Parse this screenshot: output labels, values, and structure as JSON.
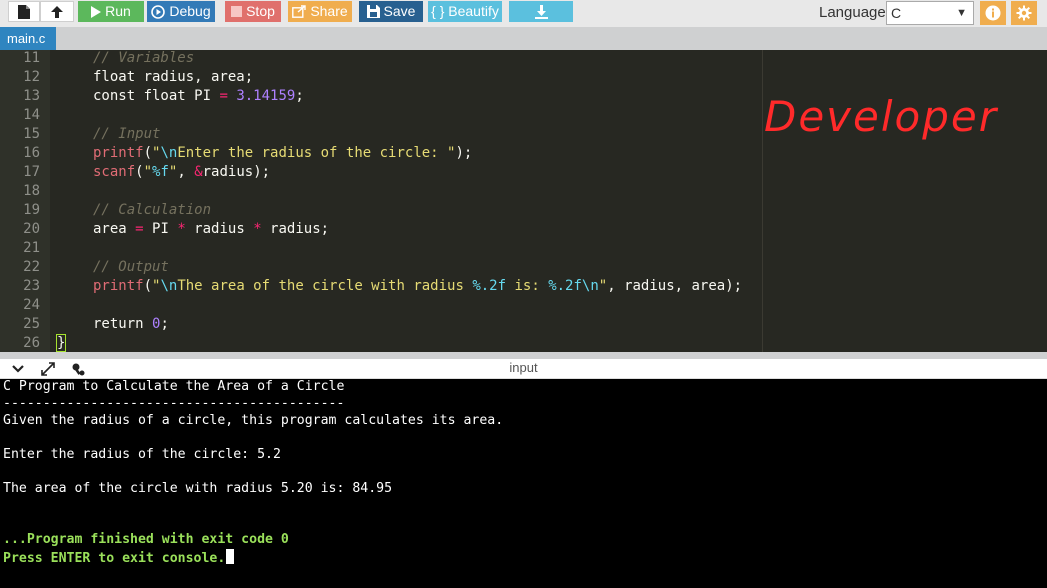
{
  "toolbar": {
    "run_label": "Run",
    "debug_label": "Debug",
    "stop_label": "Stop",
    "share_label": "Share",
    "save_label": "Save",
    "beautify_label": "{ } Beautify",
    "language_label": "Language",
    "language_value": "C",
    "icons": [
      "new-file-icon",
      "upload-icon",
      "play-icon",
      "debug-icon",
      "stop-icon",
      "share-icon",
      "save-icon",
      "download-icon",
      "info-icon",
      "gear-icon"
    ],
    "colors": {
      "run": "#5cb85c",
      "debug": "#337ab7",
      "stop": "#d9534f",
      "share": "#f0ad4e",
      "save": "#286090",
      "beautify": "#5bc0de",
      "download": "#5bc0de",
      "round": "#f0ad4e"
    }
  },
  "tabs": [
    {
      "label": "main.c"
    }
  ],
  "editor": {
    "line_numbers": [
      "11",
      "12",
      "13",
      "14",
      "15",
      "16",
      "17",
      "18",
      "19",
      "20",
      "21",
      "22",
      "23",
      "24",
      "25",
      "26"
    ],
    "lines": [
      "// Variables",
      "float radius, area;",
      "const float PI = 3.14159;",
      "",
      "// Input",
      "printf(\"\\nEnter the radius of the circle: \");",
      "scanf(\"%f\", &radius);",
      "",
      "// Calculation",
      "area = PI * radius * radius;",
      "",
      "// Output",
      "printf(\"\\nThe area of the circle with radius %.2f is: %.2f\\n\", radius, area);",
      "",
      "return 0;",
      "}"
    ],
    "watermark": "Developer"
  },
  "io": {
    "title": "input",
    "icons": [
      "chevron-down-icon",
      "expand-icon",
      "settings-icon"
    ]
  },
  "console": {
    "lines": [
      "C Program to Calculate the Area of a Circle",
      "-------------------------------------------",
      "Given the radius of a circle, this program calculates its area.",
      "",
      "Enter the radius of the circle: 5.2",
      "",
      "The area of the circle with radius 5.20 is: 84.95",
      "",
      "",
      "...Program finished with exit code 0",
      "Press ENTER to exit console."
    ]
  }
}
